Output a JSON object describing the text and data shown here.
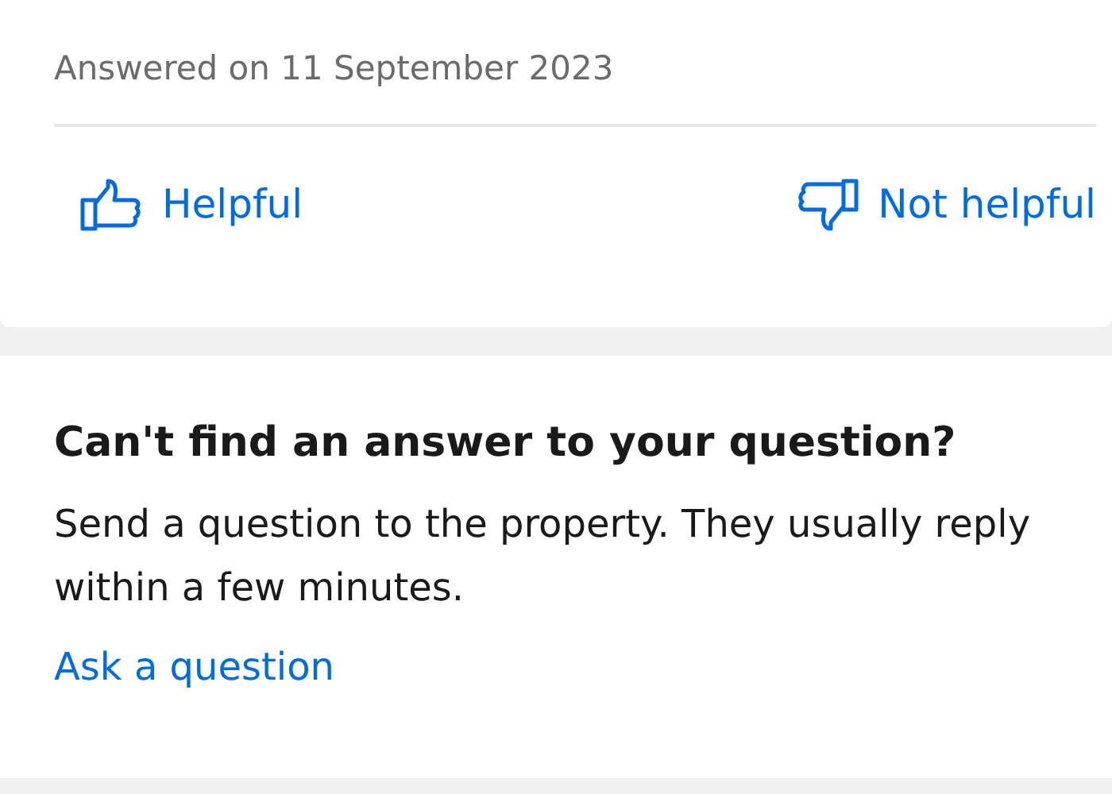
{
  "answer": {
    "date": "Answered on 11 September 2023",
    "helpful": "Helpful",
    "not_helpful": "Not helpful"
  },
  "ask": {
    "title": "Can't find an answer to your question?",
    "body": "Send a question to the property. They usually reply within a few minutes.",
    "link": "Ask a question"
  }
}
